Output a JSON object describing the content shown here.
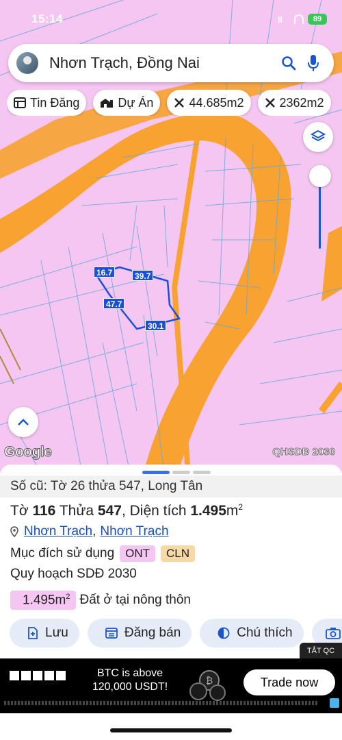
{
  "status": {
    "time": "15:14",
    "battery": "89"
  },
  "search": {
    "location": "Nhơn Trạch, Đồng Nai"
  },
  "chips": [
    {
      "label": "Tin Đăng",
      "icon": "listing-icon"
    },
    {
      "label": "Dự Án",
      "icon": "building-icon"
    },
    {
      "label": "44.685m2",
      "icon": "measure-icon"
    },
    {
      "label": "2362m2",
      "icon": "measure-icon"
    }
  ],
  "map": {
    "dimensions": [
      "16.7",
      "39.7",
      "47.7",
      "30.1"
    ],
    "logo": "Google",
    "layer_label": "QHSDĐ 2030",
    "colors": {
      "land": "#f6c6f2",
      "road": "#f7a231",
      "parcel_line": "#6aa8d8",
      "selected": "#1a4fd6"
    }
  },
  "sheet": {
    "old_number": "Số cũ: Tờ 26 thửa 547, Long Tân",
    "parcel": {
      "sheet_label": "Tờ",
      "sheet_no": "116",
      "lot_label": "Thửa",
      "lot_no": "547",
      "area_label": "Diện tích",
      "area": "1.495",
      "unit": "m",
      "unit_sup": "2"
    },
    "district": "Nhơn Trạch",
    "commune": "Nhơn Trạch",
    "separator": ",",
    "purpose_label": "Mục đích sử dụng",
    "purpose_tags": [
      "ONT",
      "CLN"
    ],
    "plan": "Quy hoạch SDĐ 2030",
    "area_badge": "1.495m",
    "area_badge_sup": "2",
    "area_desc": "Đất ở tại nông thôn",
    "actions": [
      {
        "label": "Lưu",
        "icon": "save-icon"
      },
      {
        "label": "Đăng bán",
        "icon": "calendar-icon"
      },
      {
        "label": "Chú thích",
        "icon": "legend-icon"
      },
      {
        "label": "",
        "icon": "camera-icon"
      }
    ]
  },
  "ads": {
    "hide_label": "TẮT QC",
    "headline": "BTC is above 120,000 USDT!",
    "cta": "Trade now"
  }
}
